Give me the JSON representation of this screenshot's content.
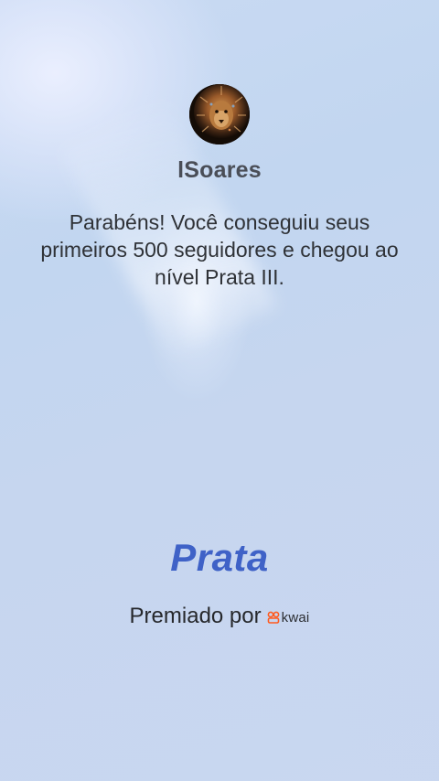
{
  "profile": {
    "username": "lSoares",
    "avatar_icon": "lion-avatar-icon"
  },
  "message": {
    "text": "Parabéns! Você conseguiu seus primeiros 500 seguidores e chegou ao nível Prata III."
  },
  "level": {
    "name": "Prata",
    "color": "#3f62c7"
  },
  "awarded": {
    "label": "Premiado por",
    "brand_logo": "kwai-logo",
    "brand_text": "kwai",
    "brand_color": "#ff5a1f"
  },
  "colors": {
    "background": "#c6d6ef",
    "text_primary": "#2f3237",
    "username": "#4a4e57"
  }
}
